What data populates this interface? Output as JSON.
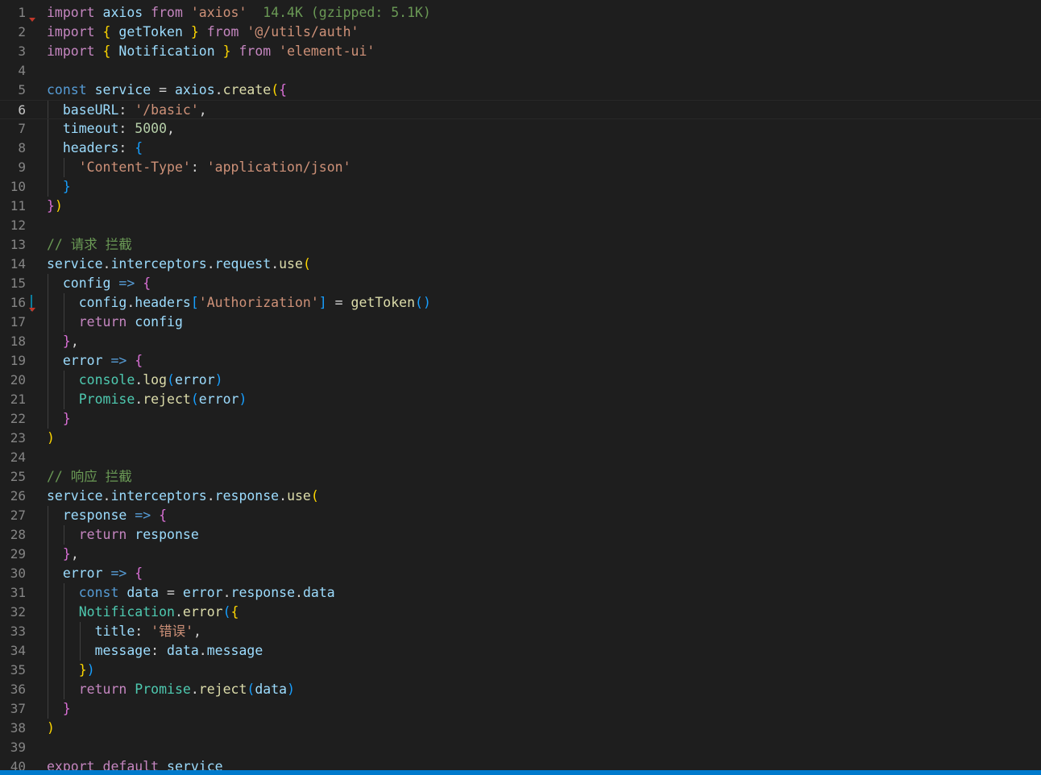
{
  "editor": {
    "active_line": 6,
    "modified_lines": [
      16
    ],
    "lines": [
      {
        "n": "1",
        "t": [
          [
            "import",
            "kw-ctrl"
          ],
          [
            " ",
            "pun"
          ],
          [
            "axios",
            "var"
          ],
          [
            " ",
            "pun"
          ],
          [
            "from",
            "kw-ctrl"
          ],
          [
            " ",
            "pun"
          ],
          [
            "'axios'",
            "str"
          ],
          [
            "  14.4K (gzipped: 5.1K)",
            "cmt-size"
          ]
        ]
      },
      {
        "n": "2",
        "t": [
          [
            "import",
            "kw-ctrl"
          ],
          [
            " ",
            "pun"
          ],
          [
            "{",
            "b1"
          ],
          [
            " ",
            "pun"
          ],
          [
            "getToken",
            "var"
          ],
          [
            " ",
            "pun"
          ],
          [
            "}",
            "b1"
          ],
          [
            " ",
            "pun"
          ],
          [
            "from",
            "kw-ctrl"
          ],
          [
            " ",
            "pun"
          ],
          [
            "'@/utils/auth'",
            "str"
          ]
        ]
      },
      {
        "n": "3",
        "t": [
          [
            "import",
            "kw-ctrl"
          ],
          [
            " ",
            "pun"
          ],
          [
            "{",
            "b1"
          ],
          [
            " ",
            "pun"
          ],
          [
            "Notification",
            "var"
          ],
          [
            " ",
            "pun"
          ],
          [
            "}",
            "b1"
          ],
          [
            " ",
            "pun"
          ],
          [
            "from",
            "kw-ctrl"
          ],
          [
            " ",
            "pun"
          ],
          [
            "'element-ui'",
            "str"
          ]
        ]
      },
      {
        "n": "4",
        "t": []
      },
      {
        "n": "5",
        "t": [
          [
            "const",
            "kw"
          ],
          [
            " ",
            "pun"
          ],
          [
            "service",
            "var"
          ],
          [
            " = ",
            "pun"
          ],
          [
            "axios",
            "var"
          ],
          [
            ".",
            "pun"
          ],
          [
            "create",
            "fn"
          ],
          [
            "(",
            "b1"
          ],
          [
            "{",
            "b2"
          ]
        ]
      },
      {
        "n": "6",
        "t": [
          [
            "  ",
            "pun"
          ],
          [
            "baseURL",
            "var"
          ],
          [
            ": ",
            "pun"
          ],
          [
            "'/basic'",
            "str"
          ],
          [
            ",",
            "pun"
          ]
        ]
      },
      {
        "n": "7",
        "t": [
          [
            "  ",
            "pun"
          ],
          [
            "timeout",
            "var"
          ],
          [
            ": ",
            "pun"
          ],
          [
            "5000",
            "num"
          ],
          [
            ",",
            "pun"
          ]
        ]
      },
      {
        "n": "8",
        "t": [
          [
            "  ",
            "pun"
          ],
          [
            "headers",
            "var"
          ],
          [
            ": ",
            "pun"
          ],
          [
            "{",
            "b3"
          ]
        ]
      },
      {
        "n": "9",
        "t": [
          [
            "    ",
            "pun"
          ],
          [
            "'Content-Type'",
            "str"
          ],
          [
            ": ",
            "pun"
          ],
          [
            "'application/json'",
            "str"
          ]
        ]
      },
      {
        "n": "10",
        "t": [
          [
            "  ",
            "pun"
          ],
          [
            "}",
            "b3"
          ]
        ]
      },
      {
        "n": "11",
        "t": [
          [
            "}",
            "b2"
          ],
          [
            ")",
            "b1"
          ]
        ]
      },
      {
        "n": "12",
        "t": []
      },
      {
        "n": "13",
        "t": [
          [
            "// 请求 拦截",
            "cmt"
          ]
        ]
      },
      {
        "n": "14",
        "t": [
          [
            "service",
            "var"
          ],
          [
            ".",
            "pun"
          ],
          [
            "interceptors",
            "var"
          ],
          [
            ".",
            "pun"
          ],
          [
            "request",
            "var"
          ],
          [
            ".",
            "pun"
          ],
          [
            "use",
            "fn"
          ],
          [
            "(",
            "b1"
          ]
        ]
      },
      {
        "n": "15",
        "t": [
          [
            "  ",
            "pun"
          ],
          [
            "config",
            "var"
          ],
          [
            " ",
            "pun"
          ],
          [
            "=>",
            "kw"
          ],
          [
            " ",
            "pun"
          ],
          [
            "{",
            "b2"
          ]
        ]
      },
      {
        "n": "16",
        "t": [
          [
            "    ",
            "pun"
          ],
          [
            "config",
            "var"
          ],
          [
            ".",
            "pun"
          ],
          [
            "headers",
            "var"
          ],
          [
            "[",
            "b3"
          ],
          [
            "'Authorization'",
            "str"
          ],
          [
            "]",
            "b3"
          ],
          [
            " = ",
            "pun"
          ],
          [
            "getToken",
            "fn"
          ],
          [
            "()",
            "b3"
          ]
        ]
      },
      {
        "n": "17",
        "t": [
          [
            "    ",
            "pun"
          ],
          [
            "return",
            "kw-ctrl"
          ],
          [
            " ",
            "pun"
          ],
          [
            "config",
            "var"
          ]
        ]
      },
      {
        "n": "18",
        "t": [
          [
            "  ",
            "pun"
          ],
          [
            "}",
            "b2"
          ],
          [
            ",",
            "pun"
          ]
        ]
      },
      {
        "n": "19",
        "t": [
          [
            "  ",
            "pun"
          ],
          [
            "error",
            "var"
          ],
          [
            " ",
            "pun"
          ],
          [
            "=>",
            "kw"
          ],
          [
            " ",
            "pun"
          ],
          [
            "{",
            "b2"
          ]
        ]
      },
      {
        "n": "20",
        "t": [
          [
            "    ",
            "pun"
          ],
          [
            "console",
            "cls"
          ],
          [
            ".",
            "pun"
          ],
          [
            "log",
            "fn"
          ],
          [
            "(",
            "b3"
          ],
          [
            "error",
            "var"
          ],
          [
            ")",
            "b3"
          ]
        ]
      },
      {
        "n": "21",
        "t": [
          [
            "    ",
            "pun"
          ],
          [
            "Promise",
            "cls"
          ],
          [
            ".",
            "pun"
          ],
          [
            "reject",
            "fn"
          ],
          [
            "(",
            "b3"
          ],
          [
            "error",
            "var"
          ],
          [
            ")",
            "b3"
          ]
        ]
      },
      {
        "n": "22",
        "t": [
          [
            "  ",
            "pun"
          ],
          [
            "}",
            "b2"
          ]
        ]
      },
      {
        "n": "23",
        "t": [
          [
            ")",
            "b1"
          ]
        ]
      },
      {
        "n": "24",
        "t": []
      },
      {
        "n": "25",
        "t": [
          [
            "// 响应 拦截",
            "cmt"
          ]
        ]
      },
      {
        "n": "26",
        "t": [
          [
            "service",
            "var"
          ],
          [
            ".",
            "pun"
          ],
          [
            "interceptors",
            "var"
          ],
          [
            ".",
            "pun"
          ],
          [
            "response",
            "var"
          ],
          [
            ".",
            "pun"
          ],
          [
            "use",
            "fn"
          ],
          [
            "(",
            "b1"
          ]
        ]
      },
      {
        "n": "27",
        "t": [
          [
            "  ",
            "pun"
          ],
          [
            "response",
            "var"
          ],
          [
            " ",
            "pun"
          ],
          [
            "=>",
            "kw"
          ],
          [
            " ",
            "pun"
          ],
          [
            "{",
            "b2"
          ]
        ]
      },
      {
        "n": "28",
        "t": [
          [
            "    ",
            "pun"
          ],
          [
            "return",
            "kw-ctrl"
          ],
          [
            " ",
            "pun"
          ],
          [
            "response",
            "var"
          ]
        ]
      },
      {
        "n": "29",
        "t": [
          [
            "  ",
            "pun"
          ],
          [
            "}",
            "b2"
          ],
          [
            ",",
            "pun"
          ]
        ]
      },
      {
        "n": "30",
        "t": [
          [
            "  ",
            "pun"
          ],
          [
            "error",
            "var"
          ],
          [
            " ",
            "pun"
          ],
          [
            "=>",
            "kw"
          ],
          [
            " ",
            "pun"
          ],
          [
            "{",
            "b2"
          ]
        ]
      },
      {
        "n": "31",
        "t": [
          [
            "    ",
            "pun"
          ],
          [
            "const",
            "kw"
          ],
          [
            " ",
            "pun"
          ],
          [
            "data",
            "var"
          ],
          [
            " = ",
            "pun"
          ],
          [
            "error",
            "var"
          ],
          [
            ".",
            "pun"
          ],
          [
            "response",
            "var"
          ],
          [
            ".",
            "pun"
          ],
          [
            "data",
            "var"
          ]
        ]
      },
      {
        "n": "32",
        "t": [
          [
            "    ",
            "pun"
          ],
          [
            "Notification",
            "cls"
          ],
          [
            ".",
            "pun"
          ],
          [
            "error",
            "fn"
          ],
          [
            "(",
            "b3"
          ],
          [
            "{",
            "b1"
          ]
        ]
      },
      {
        "n": "33",
        "t": [
          [
            "      ",
            "pun"
          ],
          [
            "title",
            "var"
          ],
          [
            ": ",
            "pun"
          ],
          [
            "'错误'",
            "str"
          ],
          [
            ",",
            "pun"
          ]
        ]
      },
      {
        "n": "34",
        "t": [
          [
            "      ",
            "pun"
          ],
          [
            "message",
            "var"
          ],
          [
            ": ",
            "pun"
          ],
          [
            "data",
            "var"
          ],
          [
            ".",
            "pun"
          ],
          [
            "message",
            "var"
          ]
        ]
      },
      {
        "n": "35",
        "t": [
          [
            "    ",
            "pun"
          ],
          [
            "}",
            "b1"
          ],
          [
            ")",
            "b3"
          ]
        ]
      },
      {
        "n": "36",
        "t": [
          [
            "    ",
            "pun"
          ],
          [
            "return",
            "kw-ctrl"
          ],
          [
            " ",
            "pun"
          ],
          [
            "Promise",
            "cls"
          ],
          [
            ".",
            "pun"
          ],
          [
            "reject",
            "fn"
          ],
          [
            "(",
            "b3"
          ],
          [
            "data",
            "var"
          ],
          [
            ")",
            "b3"
          ]
        ]
      },
      {
        "n": "37",
        "t": [
          [
            "  ",
            "pun"
          ],
          [
            "}",
            "b2"
          ]
        ]
      },
      {
        "n": "38",
        "t": [
          [
            ")",
            "b1"
          ]
        ]
      },
      {
        "n": "39",
        "t": []
      },
      {
        "n": "40",
        "t": [
          [
            "export",
            "kw-ctrl"
          ],
          [
            " ",
            "pun"
          ],
          [
            "default",
            "kw-ctrl"
          ],
          [
            " ",
            "pun"
          ],
          [
            "service",
            "var"
          ]
        ]
      }
    ]
  }
}
